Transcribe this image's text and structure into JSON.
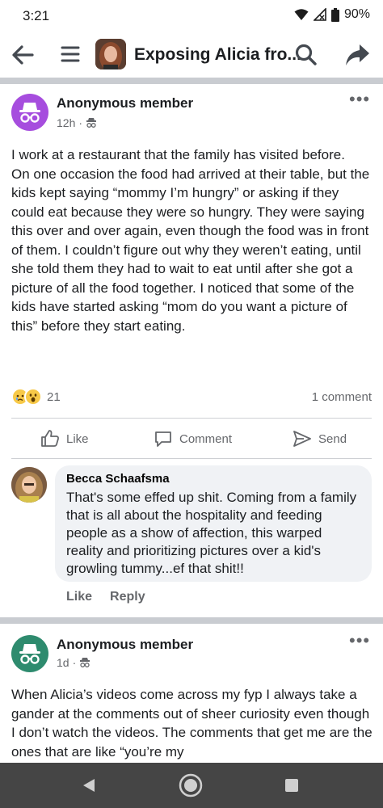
{
  "status": {
    "time": "3:21",
    "battery": "90%"
  },
  "header": {
    "title": "Exposing Alicia fro...",
    "icons": [
      "arrow-left-icon",
      "hamburger-menu-icon",
      "search-icon",
      "share-icon"
    ]
  },
  "posts": [
    {
      "author": "Anonymous member",
      "time": "12h",
      "body": [
        "I work at a restaurant that the family has visited before.",
        "On one occasion the food had arrived at their table, but the kids kept saying “mommy I’m hungry” or asking if they could eat because they were so hungry. They were saying this over and over again, even though the food was in front of them. I couldn’t figure out why they weren’t eating, until she told them they had to wait to eat until after she got a picture of all the food together. I noticed that some of the kids have started asking “mom do you want a picture of this” before they start eating."
      ],
      "reaction_count": "21",
      "comment_count": "1 comment",
      "actions": {
        "like": "Like",
        "comment": "Comment",
        "send": "Send"
      },
      "comment": {
        "name": "Becca Schaafsma",
        "text": "That's some effed up shit. Coming from a family that is all about the hospitality and feeding people as a show of affection, this warped reality and prioritizing pictures over a kid's growling tummy...ef that shit!!",
        "like": "Like",
        "reply": "Reply"
      }
    },
    {
      "author": "Anonymous member",
      "time": "1d",
      "body": [
        "When Alicia’s videos come across my fyp I always take a gander at the comments out of sheer curiosity even though I don’t watch the videos. The comments that get me are the ones that are like “you’re my"
      ]
    }
  ],
  "colors": {
    "anon_avatar_1": "#a64dde",
    "anon_avatar_2": "#2e8b6e",
    "separator": "#c9ccd1",
    "nav_bar": "#454545"
  }
}
